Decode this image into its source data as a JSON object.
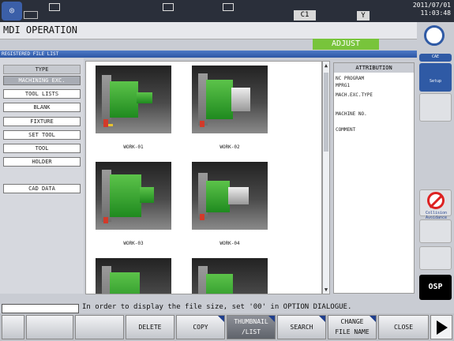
{
  "window": {
    "title": "MDI OPERATION",
    "mode": "ADJUST",
    "subtitle": "REGISTERED FILE LIST",
    "status_date": "2011/07/01",
    "status_time": "11:03:48",
    "status_c1": "C1",
    "status_y": "Y"
  },
  "left_panel": {
    "items": [
      {
        "label": "TYPE",
        "header": true
      },
      {
        "label": "MACHINING EXC.",
        "selected": true
      },
      {
        "label": "TOOL LISTS"
      },
      {
        "label": "BLANK"
      },
      {
        "label": "FIXTURE"
      },
      {
        "label": "SET TOOL"
      },
      {
        "label": "TOOL"
      },
      {
        "label": "HOLDER"
      }
    ],
    "cad_data": "CAD DATA"
  },
  "thumbnails": [
    {
      "caption": "WORK-01"
    },
    {
      "caption": "WORK-02"
    },
    {
      "caption": "WORK-03"
    },
    {
      "caption": "WORK-04"
    },
    {
      "caption": ""
    },
    {
      "caption": ""
    }
  ],
  "attribution": {
    "header": "ATTRIBUTION",
    "lines": [
      "NC PROGRAM",
      "  MPRG1",
      "MACH.EXC.TYPE",
      "",
      "MACHINE NO.",
      "",
      "COMMENT"
    ]
  },
  "message": "In order to display the file size, set '00' in OPTION DIALOGUE.",
  "function_keys": [
    {
      "line1": "",
      "line2": ""
    },
    {
      "line1": "",
      "line2": ""
    },
    {
      "line1": "",
      "line2": ""
    },
    {
      "line1": "DELETE",
      "line2": ""
    },
    {
      "line1": "COPY",
      "line2": ""
    },
    {
      "line1": "THUMBNAIL",
      "line2": "/LIST"
    },
    {
      "line1": "SEARCH",
      "line2": ""
    },
    {
      "line1": "CHANGE",
      "line2": "FILE NAME"
    },
    {
      "line1": "CLOSE",
      "line2": ""
    }
  ],
  "right_sidebar": {
    "setup_label": "Setup",
    "cae_label": "CAE",
    "collision_label": "Collision Avoidance",
    "osp_label": "OSP"
  },
  "colors": {
    "accent_green": "#78c43b",
    "header_blue": "#2d57a5"
  }
}
